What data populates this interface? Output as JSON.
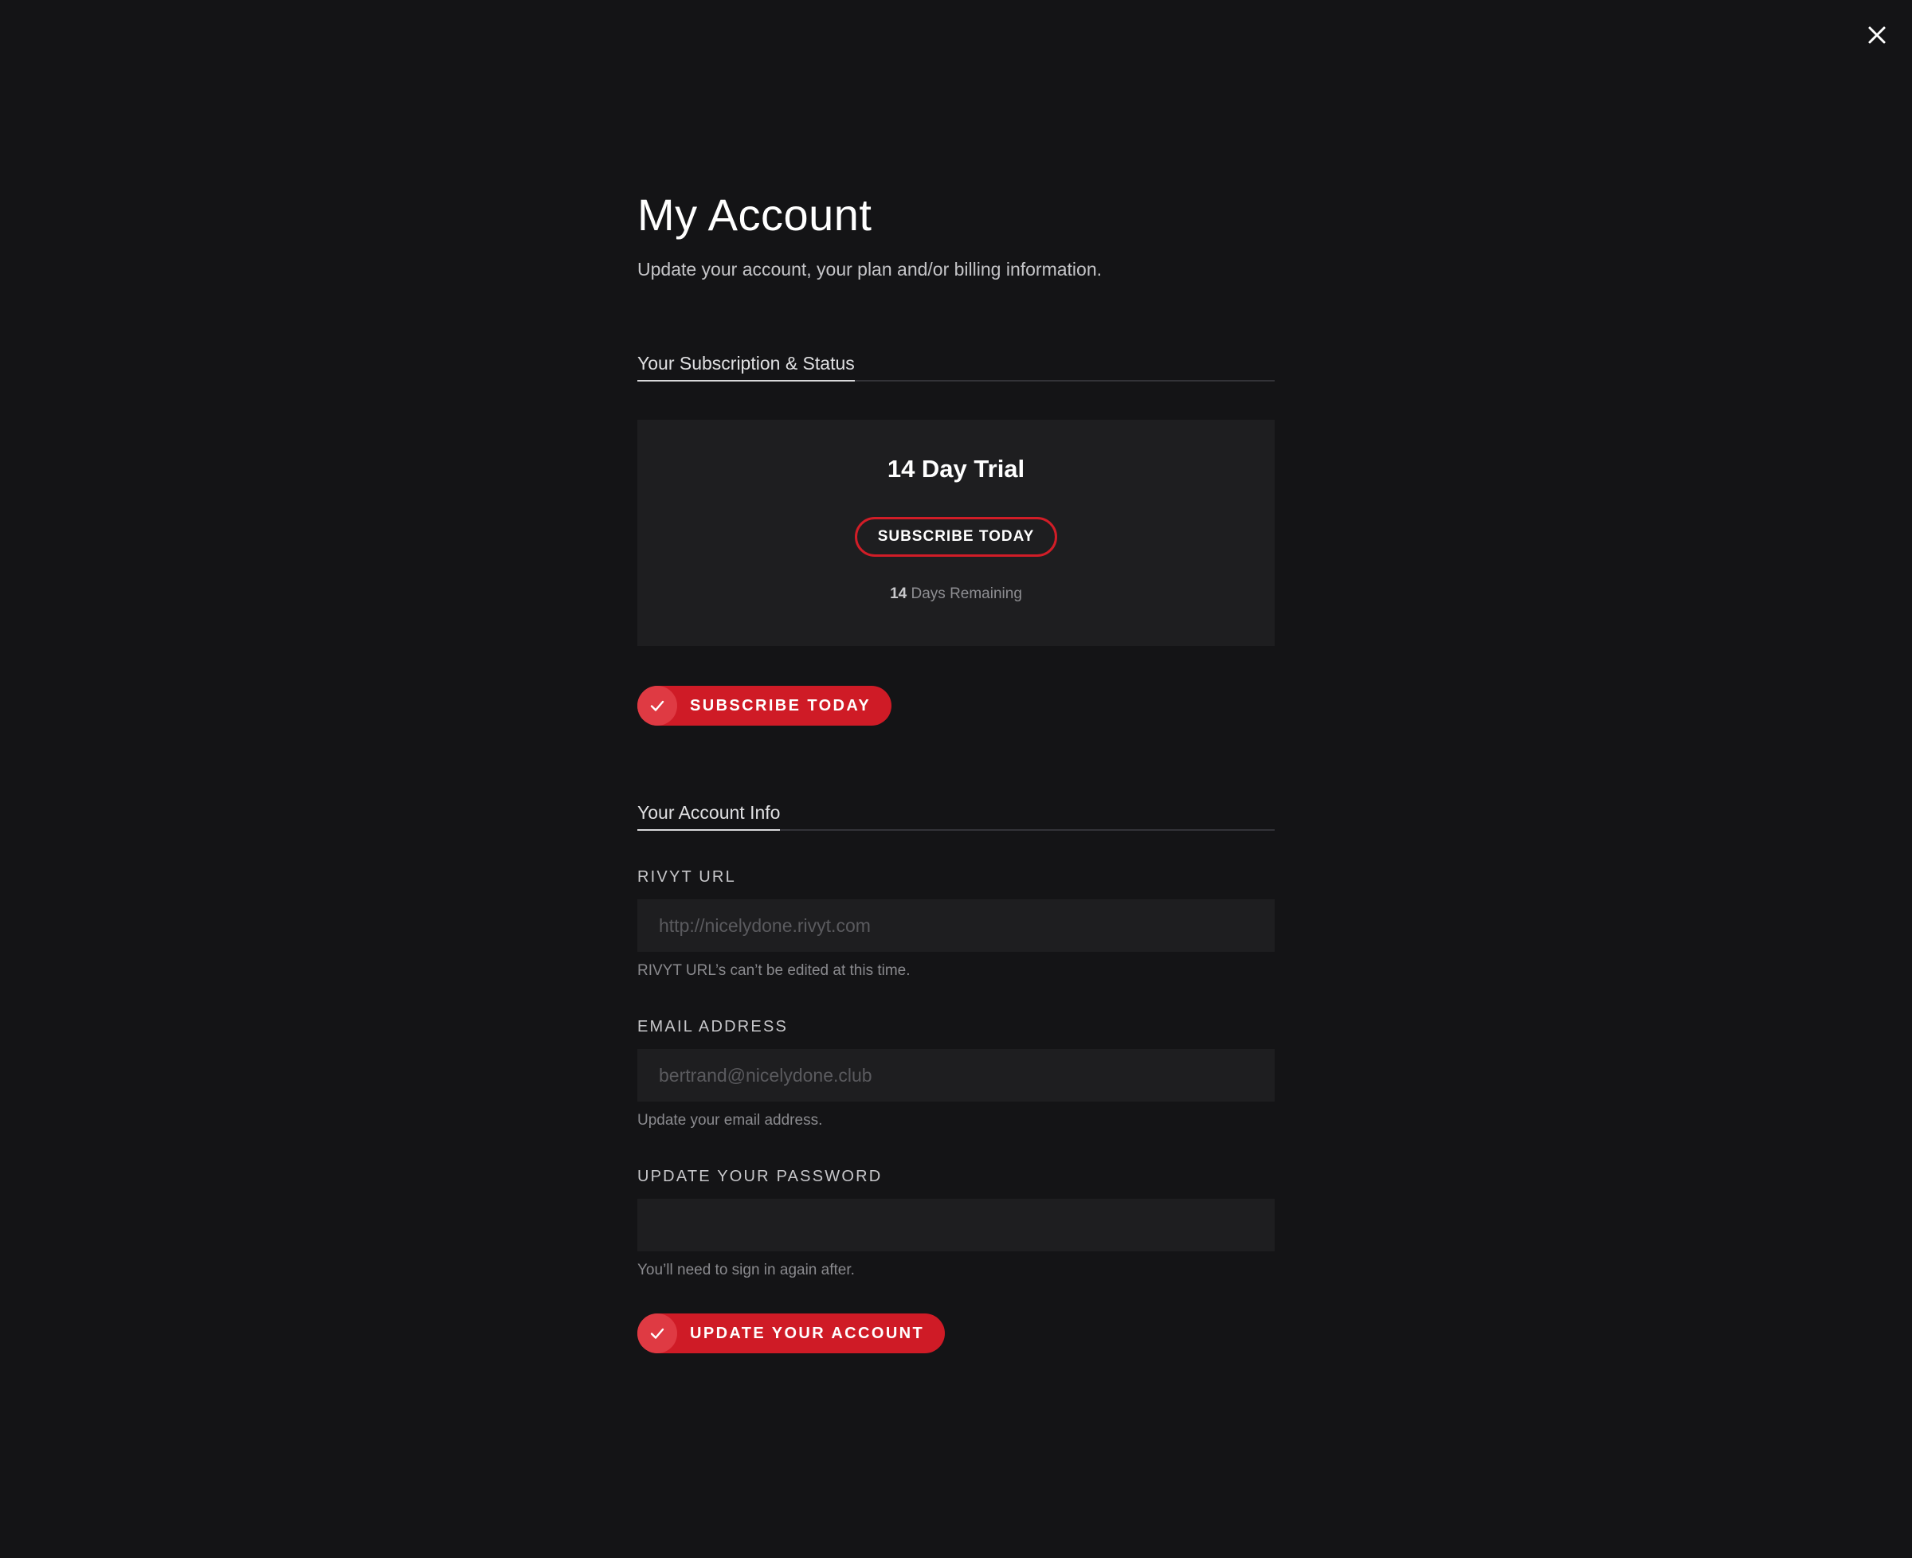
{
  "header": {
    "title": "My Account",
    "subtitle": "Update your account, your plan and/or billing information."
  },
  "subscription": {
    "section_title": "Your Subscription & Status",
    "plan_name": "14 Day Trial",
    "outline_button_label": "SUBSCRIBE TODAY",
    "days_count": "14",
    "days_label": "Days Remaining",
    "primary_button_label": "SUBSCRIBE TODAY"
  },
  "account": {
    "section_title": "Your Account Info",
    "url_label": "RIVYT URL",
    "url_value": "http://nicelydone.rivyt.com",
    "url_help": "RIVYT URL’s can’t be edited at this time.",
    "email_label": "EMAIL ADDRESS",
    "email_value": "bertrand@nicelydone.club",
    "email_help": "Update your email address.",
    "password_label": "UPDATE YOUR PASSWORD",
    "password_value": "",
    "password_help": "You’ll need to sign in again after.",
    "update_button_label": "UPDATE YOUR ACCOUNT"
  },
  "icons": {
    "close": "close-icon",
    "check": "check-icon"
  },
  "colors": {
    "background": "#141416",
    "card": "#1e1e20",
    "accent": "#cf1b26"
  }
}
